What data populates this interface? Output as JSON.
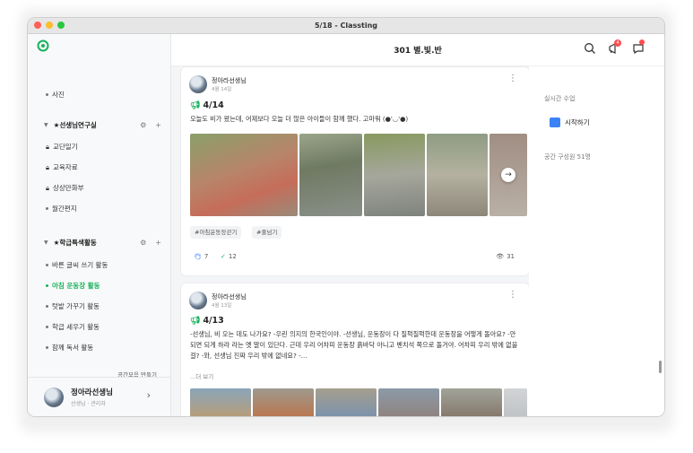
{
  "window": {
    "title": "5/18 - Classting"
  },
  "header": {
    "class_title": "301 별.빛.반",
    "notification_count": "4"
  },
  "sidebar": {
    "photos_label": "사진",
    "group_teacher": {
      "label": "★선생님연구실"
    },
    "teacher_items": [
      "교단일기",
      "교육자료",
      "상상만화부",
      "월간편지"
    ],
    "group_class": {
      "label": "★학급특색활동"
    },
    "class_items": [
      "바른 글씨 쓰기 활동",
      "아침 운동장 활동",
      "텃밭 가꾸기 활동",
      "학급 세우기 활동",
      "함께 독서 활동"
    ],
    "active_item": "아침 운동장 활동",
    "make_space": "공간모음 만들기",
    "profile": {
      "name": "정아라선생님",
      "role": "선생님 · 관리자"
    }
  },
  "posts": [
    {
      "author": "정아라선생님",
      "date": "4월 14일",
      "title": "4/14",
      "text": "오늘도 비가 왔는데, 어제보다 오늘 더 많은 아이들이 함께 했다. 고마워 (●'◡'●)",
      "tags": [
        "#아침운동장걷기",
        "#줄넘기"
      ],
      "likes": "7",
      "checks": "12",
      "views": "31"
    },
    {
      "author": "정아라선생님",
      "date": "4월 13일",
      "title": "4/13",
      "text": "-선생님, 비 오는 데도 나가요? -우린 의지의 한국인이야. -선생님, 운동장이 다 질퍽질퍽한데 운동장을 어떻게 돌아요? -안 되면 되게 하라 라는 옛 말이 있단다. 근데 우리 어차피 운동장 흙바닥 아니고 벤치석 쪽으로 돌거야. 어차피 우리 밖에 없을걸? -와, 선생님 진짜 우리 밖에 없네요? -...",
      "more": "...더 보기"
    }
  ],
  "right_panel": {
    "live_label": "실시간 수업",
    "start_button": "시작하기",
    "members": "공간 구성원 51명"
  },
  "colors": {
    "accent": "#19b35c",
    "badge": "#ff4d4f",
    "video": "#3b82f6"
  }
}
